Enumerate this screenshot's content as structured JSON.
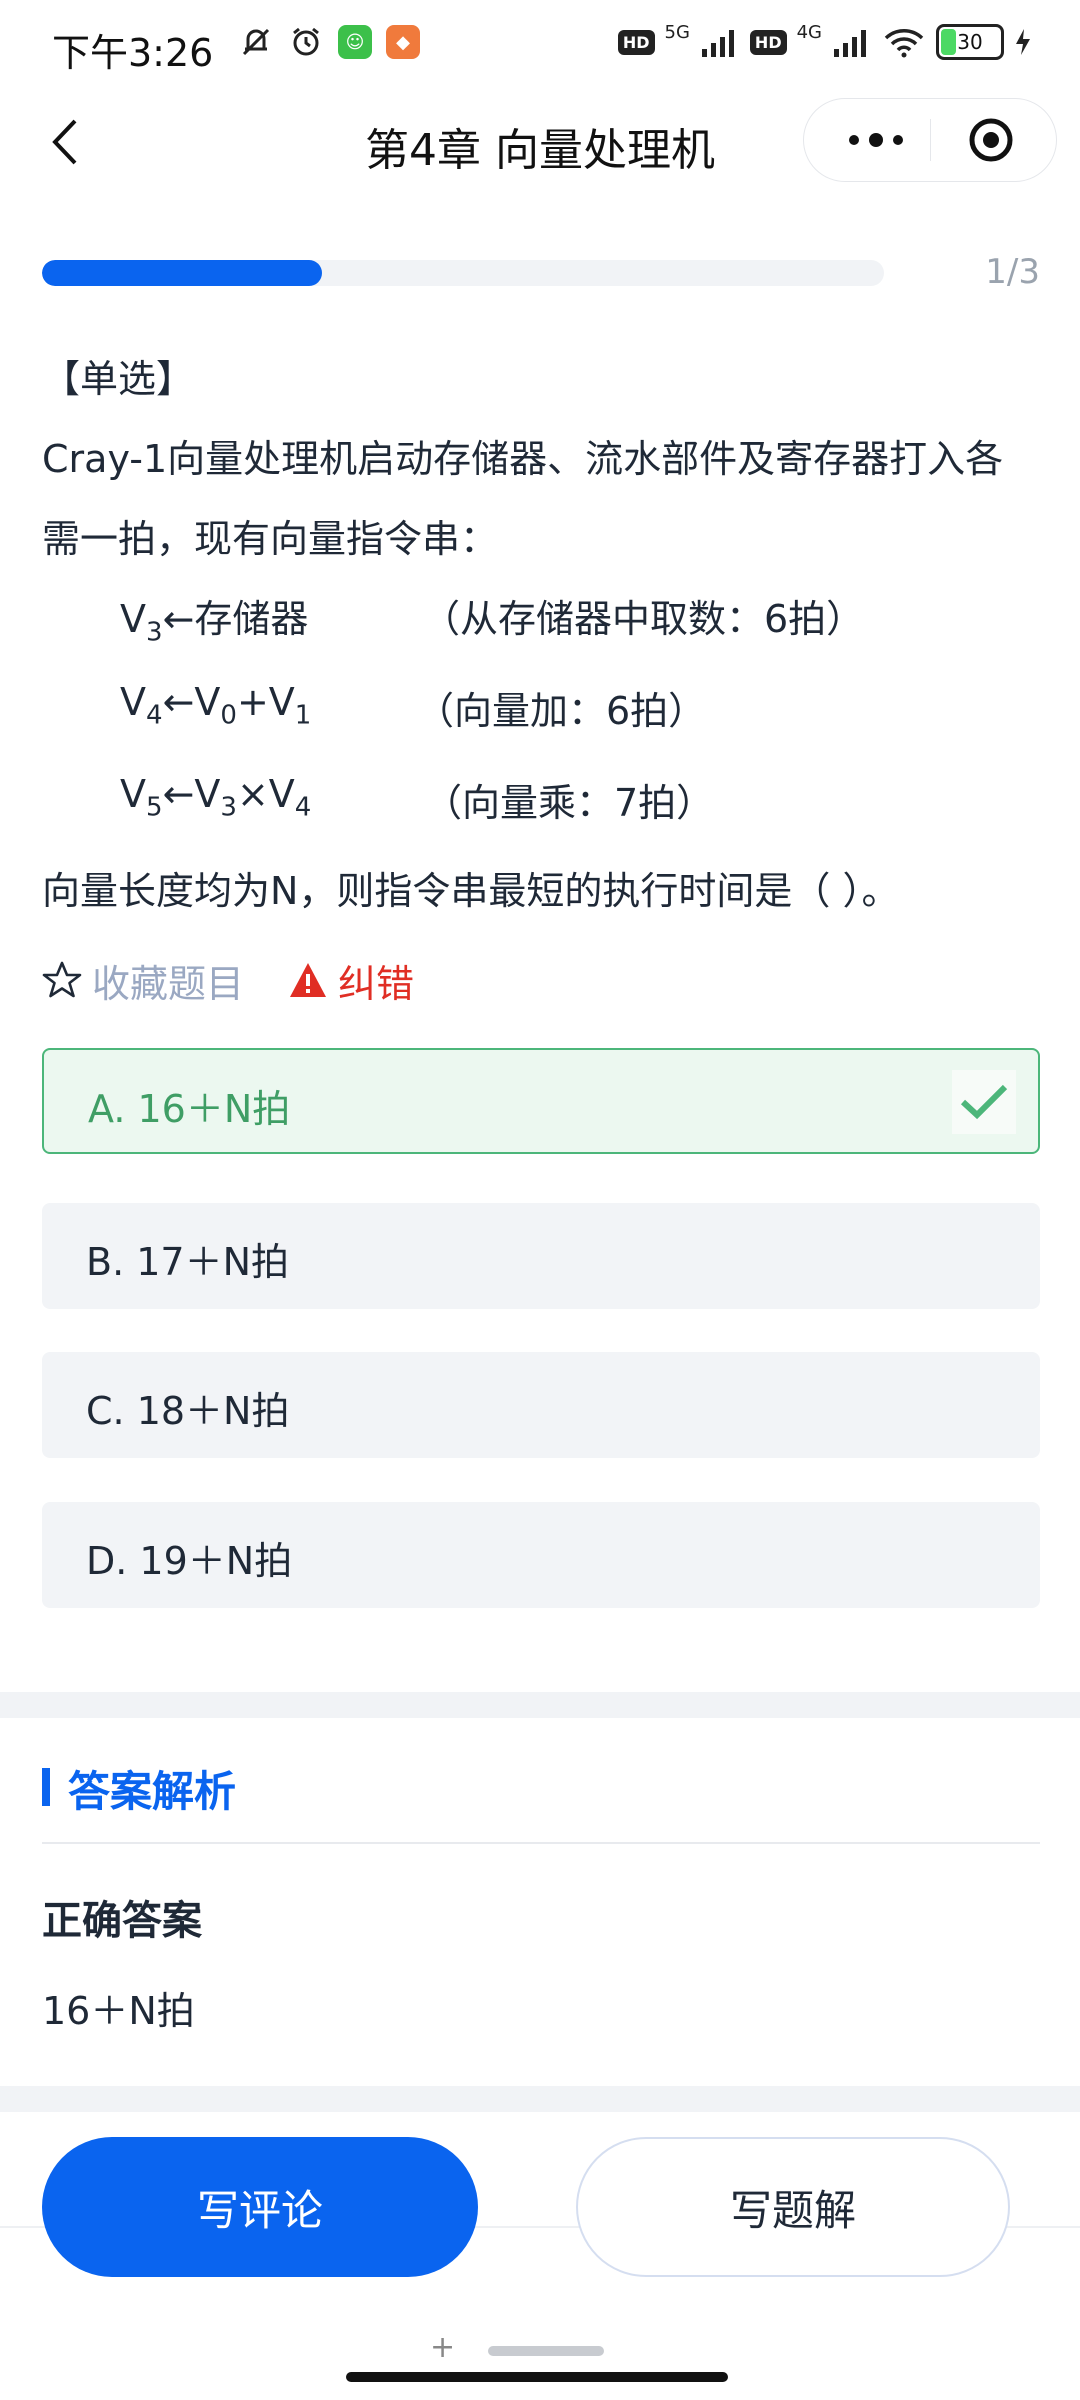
{
  "status_bar": {
    "time": "下午3:26",
    "icons_left": [
      "mute-icon",
      "alarm-icon",
      "green-app-icon",
      "orange-app-icon"
    ],
    "network_labels": [
      "HD",
      "5G",
      "HD",
      "4G"
    ],
    "battery": "30",
    "battery_level": 0.3
  },
  "nav": {
    "title": "第4章  向量处理机"
  },
  "progress": {
    "count": "1/3",
    "fraction": 0.333
  },
  "question": {
    "type": "【单选】",
    "line1": "Cray-1向量处理机启动存储器、流水部件及寄存器打入各",
    "line2": "需一拍，现有向量指令串：",
    "instructions": [
      {
        "lhs": "V",
        "lhs_sub": "3",
        "rhs": "←存储器",
        "note": "（从存储器中取数：6拍）"
      },
      {
        "lhs": "V",
        "lhs_sub": "4",
        "rhs_a": "←V",
        "rhs_a_sub": "0",
        "rhs_b": "+V",
        "rhs_b_sub": "1",
        "note": "（向量加：6拍）"
      },
      {
        "lhs": "V",
        "lhs_sub": "5",
        "rhs_a": "←V",
        "rhs_a_sub": "3",
        "rhs_b": "×V",
        "rhs_b_sub": "4",
        "note": "（向量乘：7拍）"
      }
    ],
    "end": "向量长度均为N，则指令串最短的执行时间是（   ）。"
  },
  "actions": {
    "favorite": "收藏题目",
    "report": "纠错"
  },
  "options": [
    {
      "label": "A. 16＋N拍",
      "correct": true
    },
    {
      "label": "B. 17＋N拍",
      "correct": false
    },
    {
      "label": "C. 18＋N拍",
      "correct": false
    },
    {
      "label": "D. 19＋N拍",
      "correct": false
    }
  ],
  "analysis": {
    "section_title": "答案解析",
    "answer_heading": "正确答案",
    "answer_value": "16＋N拍"
  },
  "bottom": {
    "comment_button": "写评论",
    "solution_button": "写题解"
  },
  "colors": {
    "accent": "#0a64ef",
    "correct": "#4cb67a",
    "error": "#e02e24"
  }
}
